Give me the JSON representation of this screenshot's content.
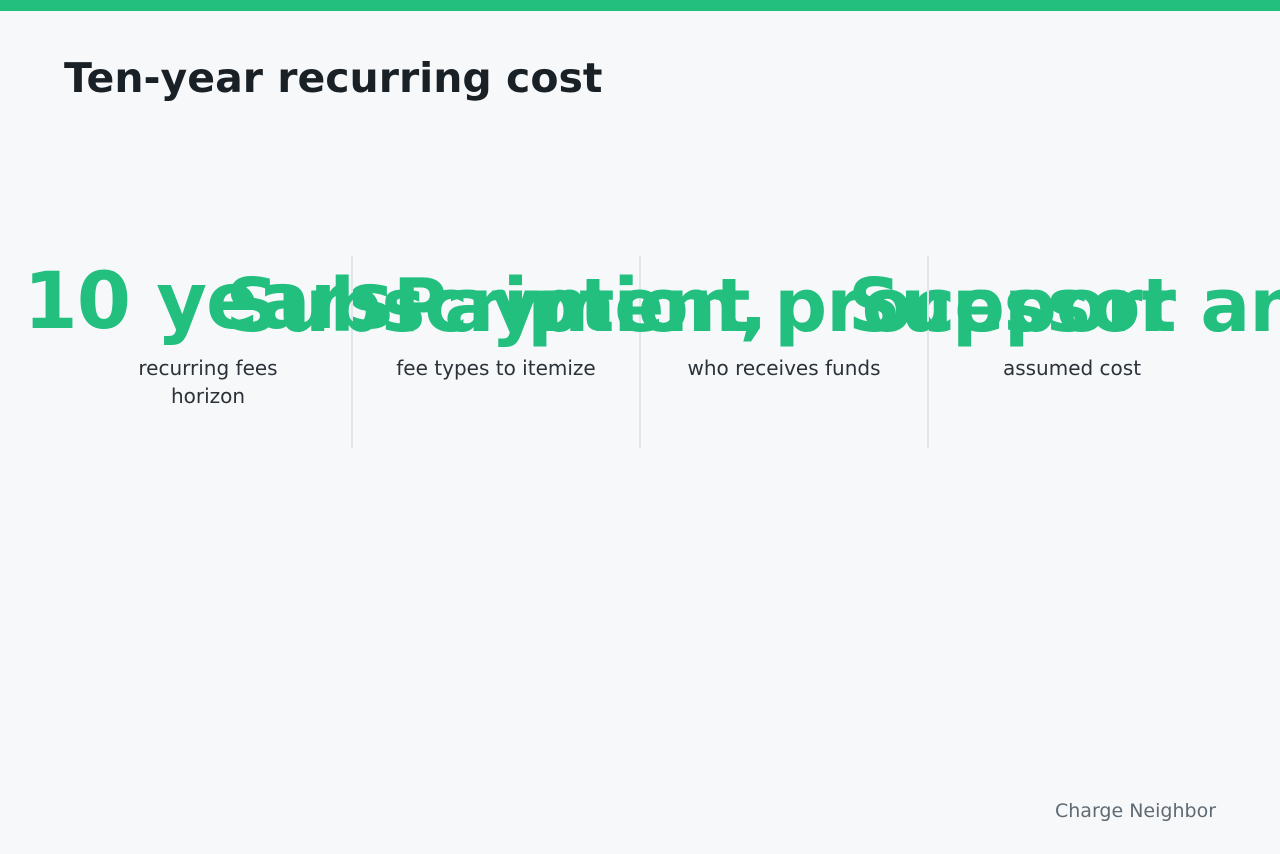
{
  "slide": {
    "title": "Ten-year recurring cost",
    "brand": "Charge Neighbor",
    "accent_color": "#22bf7f"
  },
  "stats": [
    {
      "value": "10 years",
      "label": "recurring fees horizon"
    },
    {
      "value": "Subscription,",
      "label": "fee types to itemize"
    },
    {
      "value": "Payment processor",
      "label": "who receives funds"
    },
    {
      "value": "Support and analytics",
      "label": "assumed cost"
    }
  ]
}
